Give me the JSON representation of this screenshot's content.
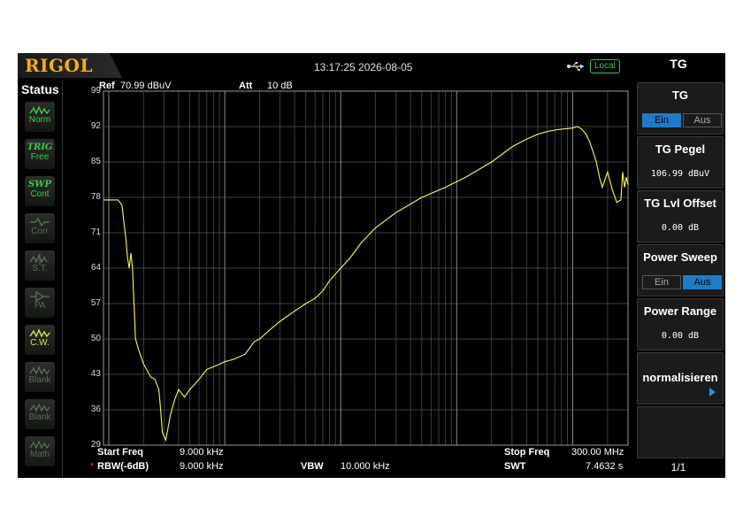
{
  "brand": "RIGOL",
  "datetime": "13:17:25 2026-08-05",
  "remote": {
    "icon": "usb-icon",
    "label": "Local"
  },
  "status": {
    "title": "Status",
    "items": [
      {
        "label": "Norm",
        "icon": "trace-wave-icon",
        "active": true
      },
      {
        "word": "TRIG",
        "label": "Free",
        "active": true
      },
      {
        "word": "SWP",
        "label": "Cont",
        "active": true
      },
      {
        "label": "Corr",
        "icon": "correction-icon",
        "active": false
      },
      {
        "label": "S.T.",
        "icon": "signal-track-icon",
        "active": false
      },
      {
        "label": "PA",
        "icon": "preamp-icon",
        "active": false
      },
      {
        "label": "C.W.",
        "icon": "cw-icon",
        "active": true
      },
      {
        "label": "Blank",
        "icon": "trace-blank-icon",
        "active": false
      },
      {
        "label": "Blank",
        "icon": "trace-blank-icon",
        "active": false
      },
      {
        "label": "Math",
        "icon": "trace-math-icon",
        "active": false
      }
    ]
  },
  "plot": {
    "ref_label": "Ref",
    "ref_value": "70.99 dBuV",
    "att_label": "Att",
    "att_value": "10 dB",
    "start_label": "Start Freq",
    "start_value": "9.000 kHz",
    "stop_label": "Stop Freq",
    "stop_value": "300.00 MHz",
    "rbw_marker": "*",
    "rbw_label": "RBW(-6dB)",
    "rbw_value": "9.000 kHz",
    "vbw_label": "VBW",
    "vbw_value": "10.000 kHz",
    "swt_label": "SWT",
    "swt_value": "7.4632 s",
    "trace_color": "#ffff33"
  },
  "chart_data": {
    "type": "line",
    "x_scale": "log",
    "xlim_hz": [
      9000,
      300000000
    ],
    "ylim": [
      29,
      99
    ],
    "y_ticks": [
      "99",
      "92",
      "85",
      "78",
      "71",
      "64",
      "57",
      "50",
      "43",
      "36",
      "29"
    ],
    "grid": true,
    "x_hz": [
      9000,
      12000,
      13000,
      13500,
      14000,
      14500,
      15000,
      15500,
      16000,
      17000,
      18000,
      20000,
      23000,
      25000,
      27000,
      28000,
      29000,
      31000,
      34000,
      37000,
      40000,
      45000,
      50000,
      60000,
      70000,
      80000,
      90000,
      100000,
      120000,
      150000,
      180000,
      200000,
      250000,
      300000,
      400000,
      500000,
      600000,
      700000,
      800000,
      1000000,
      1200000,
      1500000,
      2000000,
      3000000,
      5000000,
      8000000,
      12000000,
      20000000,
      30000000,
      40000000,
      50000000,
      60000000,
      70000000,
      80000000,
      90000000,
      100000000,
      110000000,
      120000000,
      130000000,
      140000000,
      150000000,
      160000000,
      170000000,
      180000000,
      200000000,
      220000000,
      240000000,
      260000000,
      270000000,
      280000000,
      290000000,
      300000000
    ],
    "y": [
      77.5,
      77.5,
      76.5,
      73,
      70,
      66,
      64,
      67,
      64,
      50,
      48,
      45,
      42.5,
      42,
      40,
      36,
      31.5,
      30,
      35,
      38,
      40,
      38.5,
      40,
      42,
      44,
      44.5,
      45,
      45.5,
      46,
      47,
      49.5,
      50,
      52,
      53.5,
      55.5,
      57,
      58,
      59.5,
      61.5,
      64,
      66,
      69,
      72,
      75,
      78,
      80,
      82,
      85,
      88,
      89.5,
      90.5,
      91,
      91.3,
      91.5,
      91.6,
      91.7,
      92,
      91.5,
      90.5,
      89,
      87,
      85,
      82,
      80,
      83,
      79.5,
      77,
      77.5,
      83,
      80,
      82,
      80.5
    ]
  },
  "panel": {
    "title": "TG",
    "buttons": [
      {
        "label": "TG",
        "type": "toggle",
        "on": "Ein",
        "off": "Aus",
        "active": "on"
      },
      {
        "label": "TG Pegel",
        "type": "value",
        "value": "106.99 dBuV"
      },
      {
        "label": "TG Lvl Offset",
        "type": "value",
        "value": "0.00 dB"
      },
      {
        "label": "Power Sweep",
        "type": "toggle",
        "on": "Ein",
        "off": "Aus",
        "active": "off"
      },
      {
        "label": "Power Range",
        "type": "value",
        "value": "0.00 dB"
      },
      {
        "label": "normalisieren",
        "type": "submenu"
      },
      {
        "label": "",
        "type": "empty"
      }
    ],
    "page": "1/1"
  }
}
